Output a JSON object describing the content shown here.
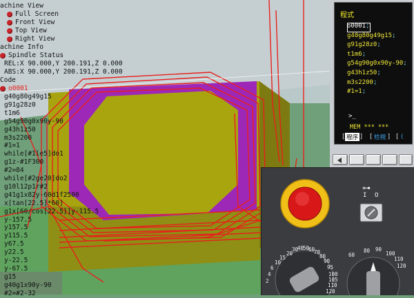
{
  "tree": {
    "view_header": "achine View",
    "views": [
      "Full Screen",
      "Front View",
      "Top View",
      "Right View"
    ],
    "info_header": "achine Info",
    "spindle": "Spindle Status",
    "rel": "REL:X  90.000,Y 200.191,Z   0.000",
    "abs": "ABS:X  90.000,Y 200.191,Z   0.000",
    "code_header": "Code",
    "program": "o0001",
    "code_lines": [
      "g40g80g49g15",
      "g91g28z0",
      "t1m6",
      "g54g90g0x90y-90",
      "g43h1z50",
      "m3s2200",
      "#1=1",
      "while[#1le5]do1",
      "g1z-#1F300",
      "#2=84",
      "while[#2ge20]do2",
      "g10l12p1r#2",
      "g41g1x82y-60d1f2500",
      "x[tan[22.5]*60]",
      "g1x[60/cos[22.5]]y-115.5",
      "y-157.5",
      "y157.5",
      "y115.5",
      "y67.5",
      "y22.5",
      "y-22.5",
      "y-67.5",
      "g15",
      "g40g1x90y-90",
      "#2=#2-32"
    ]
  },
  "cnc": {
    "title": "程式",
    "lines": [
      {
        "text": "o0001",
        "semi": ";"
      },
      {
        "text": "g40g80g49g15",
        "semi": ";"
      },
      {
        "text": "g91g28z0",
        "semi": ";"
      },
      {
        "text": "t1m6",
        "semi": ";"
      },
      {
        "text": "g54g90g0x90y-90",
        "semi": ";"
      },
      {
        "text": "g43h1z50",
        "semi": ";"
      },
      {
        "text": "m3s2200",
        "semi": ";"
      },
      {
        "text": "#1=1",
        "semi": ";"
      }
    ],
    "prompt": ">_",
    "mem": "MEM *** ***",
    "softkeys": [
      "程序",
      "检視",
      "("
    ]
  },
  "panel": {
    "key_symbol": "⊶",
    "key_positions": [
      "I",
      "O"
    ],
    "dial_left_ticks": [
      "20",
      "30",
      "40",
      "50",
      "60",
      "70",
      "80",
      "90",
      "95",
      "100",
      "105",
      "110",
      "120",
      "15",
      "10",
      "6",
      "4",
      "2"
    ],
    "dial_right_ticks": [
      "80",
      "90",
      "100",
      "110",
      "120",
      "60"
    ]
  },
  "colors": {
    "background": "#6fa07a",
    "stock_top": "#a8a410",
    "stock_side": "#8e8f14",
    "pocket_wall": "#9d28b8",
    "toolpath": "#e8201c",
    "cnc_text": "#f1e83a",
    "emergency_red": "#d81818"
  }
}
